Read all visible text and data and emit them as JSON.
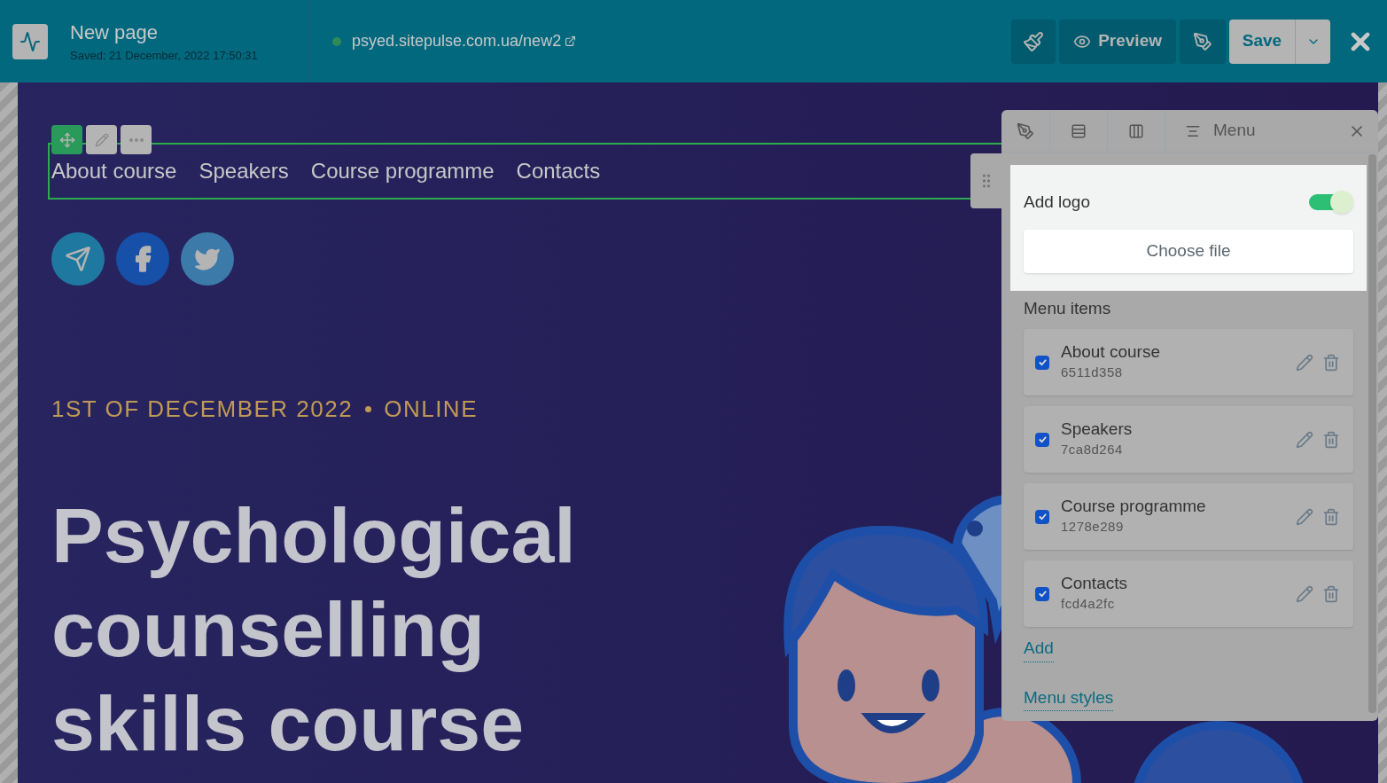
{
  "header": {
    "title": "New page",
    "saved": "Saved: 21 December, 2022 17:50:31",
    "url": "psyed.sitepulse.com.ua/new2",
    "published": true,
    "preview": "Preview",
    "save": "Save"
  },
  "canvas": {
    "nav_links": [
      "About course",
      "Speakers",
      "Course programme",
      "Contacts"
    ],
    "date": "1ST OF DECEMBER 2022",
    "format": "ONLINE",
    "headline_lines": [
      "Psychological",
      "counselling",
      "skills course"
    ]
  },
  "panel": {
    "title": "Menu",
    "add_logo": {
      "label": "Add logo",
      "on": true
    },
    "choose_file": "Choose file",
    "section": "Menu items",
    "items": [
      {
        "name": "About course",
        "id": "6511d358",
        "checked": true
      },
      {
        "name": "Speakers",
        "id": "7ca8d264",
        "checked": true
      },
      {
        "name": "Course programme",
        "id": "1278e289",
        "checked": true
      },
      {
        "name": "Contacts",
        "id": "fcd4a2fc",
        "checked": true
      }
    ],
    "add": "Add",
    "styles": "Menu styles"
  }
}
